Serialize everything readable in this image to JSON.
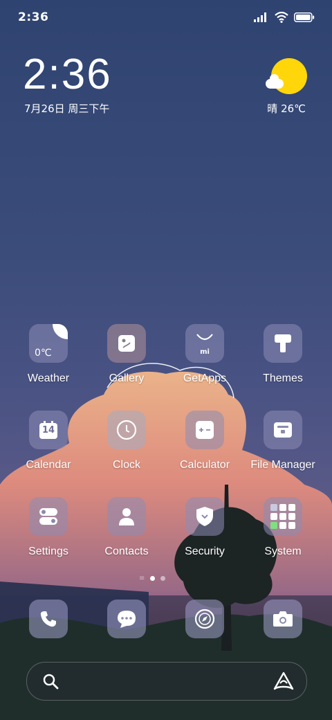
{
  "status_bar": {
    "time": "2:36"
  },
  "clock_widget": {
    "time": "2:36",
    "date": "7月26日 周三下午"
  },
  "weather_widget": {
    "condition": "晴",
    "temperature": "26℃"
  },
  "apps": [
    {
      "label": "Weather",
      "icon": "weather-icon",
      "badge": "0℃"
    },
    {
      "label": "Gallery",
      "icon": "gallery-icon"
    },
    {
      "label": "GetApps",
      "icon": "getapps-icon",
      "badge": "mi"
    },
    {
      "label": "Themes",
      "icon": "themes-icon"
    },
    {
      "label": "Calendar",
      "icon": "calendar-icon",
      "badge": "14"
    },
    {
      "label": "Clock",
      "icon": "clock-icon"
    },
    {
      "label": "Calculator",
      "icon": "calculator-icon"
    },
    {
      "label": "File Manager",
      "icon": "file-manager-icon"
    },
    {
      "label": "Settings",
      "icon": "settings-icon"
    },
    {
      "label": "Contacts",
      "icon": "contacts-icon"
    },
    {
      "label": "Security",
      "icon": "security-icon"
    },
    {
      "label": "System",
      "icon": "system-folder-icon"
    }
  ],
  "pager": {
    "pages": 2,
    "current": 1
  },
  "dock": [
    {
      "icon": "phone-icon"
    },
    {
      "icon": "messages-icon"
    },
    {
      "icon": "browser-icon"
    },
    {
      "icon": "camera-icon"
    }
  ],
  "search_bar": {
    "left_icon": "search-icon",
    "right_icon": "assistant-icon"
  },
  "colors": {
    "sun": "#ffd60a",
    "sky_top": "#2f4371",
    "cloud": "#f0a77e"
  }
}
